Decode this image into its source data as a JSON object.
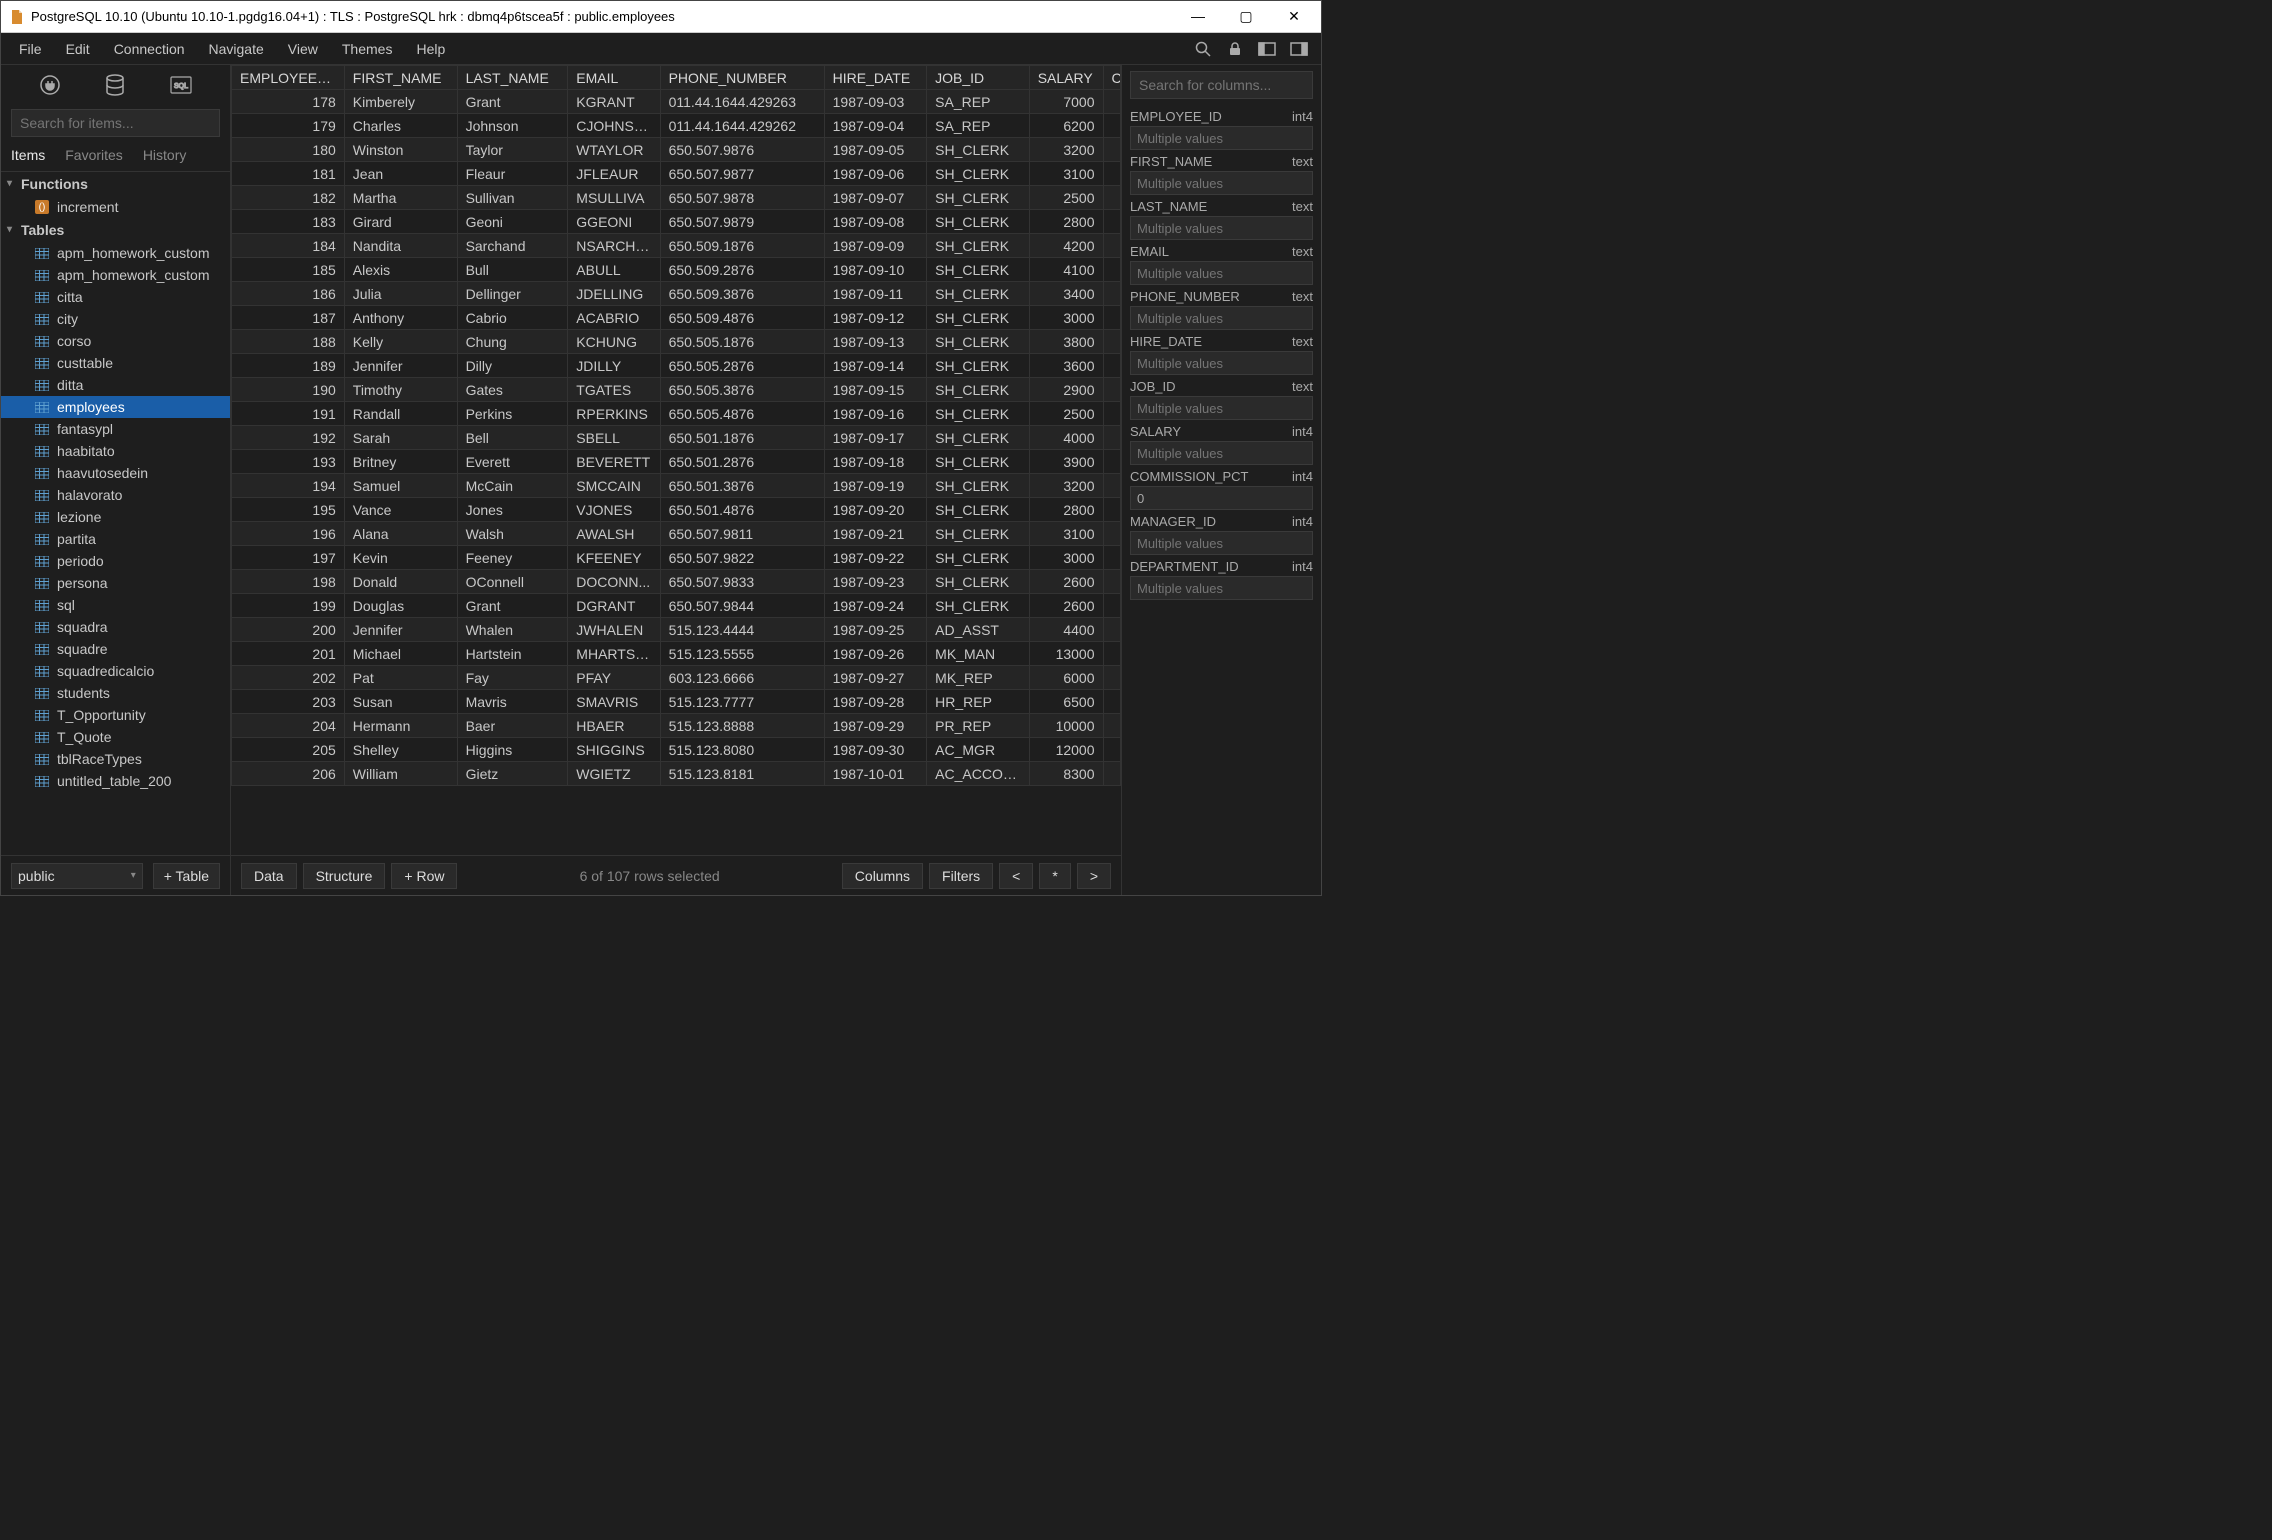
{
  "window": {
    "title": "PostgreSQL 10.10 (Ubuntu 10.10-1.pgdg16.04+1) : TLS : PostgreSQL hrk : dbmq4p6tscea5f : public.employees"
  },
  "menu": [
    "File",
    "Edit",
    "Connection",
    "Navigate",
    "View",
    "Themes",
    "Help"
  ],
  "sidebar": {
    "search_placeholder": "Search for items...",
    "tabs": [
      "Items",
      "Favorites",
      "History"
    ],
    "functions_label": "Functions",
    "tables_label": "Tables",
    "functions": [
      "increment"
    ],
    "tables": [
      "apm_homework_custom",
      "apm_homework_custom",
      "citta",
      "city",
      "corso",
      "custtable",
      "ditta",
      "employees",
      "fantasypl",
      "haabitato",
      "haavutosedein",
      "halavorato",
      "lezione",
      "partita",
      "periodo",
      "persona",
      "sql",
      "squadra",
      "squadre",
      "squadredicalcio",
      "students",
      "T_Opportunity",
      "T_Quote",
      "tblRaceTypes",
      "untitled_table_200"
    ],
    "selected_table": "employees",
    "schema": "public",
    "add_table_btn": "+ Table"
  },
  "grid": {
    "columns": [
      "EMPLOYEE_ID",
      "FIRST_NAME",
      "LAST_NAME",
      "EMAIL",
      "PHONE_NUMBER",
      "HIRE_DATE",
      "JOB_ID",
      "SALARY"
    ],
    "partial_col": "C",
    "rows": [
      [
        178,
        "Kimberely",
        "Grant",
        "KGRANT",
        "011.44.1644.429263",
        "1987-09-03",
        "SA_REP",
        7000
      ],
      [
        179,
        "Charles",
        "Johnson",
        "CJOHNSON",
        "011.44.1644.429262",
        "1987-09-04",
        "SA_REP",
        6200
      ],
      [
        180,
        "Winston",
        "Taylor",
        "WTAYLOR",
        "650.507.9876",
        "1987-09-05",
        "SH_CLERK",
        3200
      ],
      [
        181,
        "Jean",
        "Fleaur",
        "JFLEAUR",
        "650.507.9877",
        "1987-09-06",
        "SH_CLERK",
        3100
      ],
      [
        182,
        "Martha",
        "Sullivan",
        "MSULLIVA",
        "650.507.9878",
        "1987-09-07",
        "SH_CLERK",
        2500
      ],
      [
        183,
        "Girard",
        "Geoni",
        "GGEONI",
        "650.507.9879",
        "1987-09-08",
        "SH_CLERK",
        2800
      ],
      [
        184,
        "Nandita",
        "Sarchand",
        "NSARCHA...",
        "650.509.1876",
        "1987-09-09",
        "SH_CLERK",
        4200
      ],
      [
        185,
        "Alexis",
        "Bull",
        "ABULL",
        "650.509.2876",
        "1987-09-10",
        "SH_CLERK",
        4100
      ],
      [
        186,
        "Julia",
        "Dellinger",
        "JDELLING",
        "650.509.3876",
        "1987-09-11",
        "SH_CLERK",
        3400
      ],
      [
        187,
        "Anthony",
        "Cabrio",
        "ACABRIO",
        "650.509.4876",
        "1987-09-12",
        "SH_CLERK",
        3000
      ],
      [
        188,
        "Kelly",
        "Chung",
        "KCHUNG",
        "650.505.1876",
        "1987-09-13",
        "SH_CLERK",
        3800
      ],
      [
        189,
        "Jennifer",
        "Dilly",
        "JDILLY",
        "650.505.2876",
        "1987-09-14",
        "SH_CLERK",
        3600
      ],
      [
        190,
        "Timothy",
        "Gates",
        "TGATES",
        "650.505.3876",
        "1987-09-15",
        "SH_CLERK",
        2900
      ],
      [
        191,
        "Randall",
        "Perkins",
        "RPERKINS",
        "650.505.4876",
        "1987-09-16",
        "SH_CLERK",
        2500
      ],
      [
        192,
        "Sarah",
        "Bell",
        "SBELL",
        "650.501.1876",
        "1987-09-17",
        "SH_CLERK",
        4000
      ],
      [
        193,
        "Britney",
        "Everett",
        "BEVERETT",
        "650.501.2876",
        "1987-09-18",
        "SH_CLERK",
        3900
      ],
      [
        194,
        "Samuel",
        "McCain",
        "SMCCAIN",
        "650.501.3876",
        "1987-09-19",
        "SH_CLERK",
        3200
      ],
      [
        195,
        "Vance",
        "Jones",
        "VJONES",
        "650.501.4876",
        "1987-09-20",
        "SH_CLERK",
        2800
      ],
      [
        196,
        "Alana",
        "Walsh",
        "AWALSH",
        "650.507.9811",
        "1987-09-21",
        "SH_CLERK",
        3100
      ],
      [
        197,
        "Kevin",
        "Feeney",
        "KFEENEY",
        "650.507.9822",
        "1987-09-22",
        "SH_CLERK",
        3000
      ],
      [
        198,
        "Donald",
        "OConnell",
        "DOCONN...",
        "650.507.9833",
        "1987-09-23",
        "SH_CLERK",
        2600
      ],
      [
        199,
        "Douglas",
        "Grant",
        "DGRANT",
        "650.507.9844",
        "1987-09-24",
        "SH_CLERK",
        2600
      ],
      [
        200,
        "Jennifer",
        "Whalen",
        "JWHALEN",
        "515.123.4444",
        "1987-09-25",
        "AD_ASST",
        4400
      ],
      [
        201,
        "Michael",
        "Hartstein",
        "MHARTSTE",
        "515.123.5555",
        "1987-09-26",
        "MK_MAN",
        13000
      ],
      [
        202,
        "Pat",
        "Fay",
        "PFAY",
        "603.123.6666",
        "1987-09-27",
        "MK_REP",
        6000
      ],
      [
        203,
        "Susan",
        "Mavris",
        "SMAVRIS",
        "515.123.7777",
        "1987-09-28",
        "HR_REP",
        6500
      ],
      [
        204,
        "Hermann",
        "Baer",
        "HBAER",
        "515.123.8888",
        "1987-09-29",
        "PR_REP",
        10000
      ],
      [
        205,
        "Shelley",
        "Higgins",
        "SHIGGINS",
        "515.123.8080",
        "1987-09-30",
        "AC_MGR",
        12000
      ],
      [
        206,
        "William",
        "Gietz",
        "WGIETZ",
        "515.123.8181",
        "1987-10-01",
        "AC_ACCOUNT",
        8300
      ]
    ]
  },
  "footer": {
    "data_btn": "Data",
    "structure_btn": "Structure",
    "row_btn": "+ Row",
    "status": "6 of 107 rows selected",
    "columns_btn": "Columns",
    "filters_btn": "Filters",
    "nav_prev": "<",
    "nav_all": "*",
    "nav_next": ">"
  },
  "rightp": {
    "search_placeholder": "Search for columns...",
    "multi_placeholder": "Multiple values",
    "fields": [
      {
        "name": "EMPLOYEE_ID",
        "type": "int4",
        "value": ""
      },
      {
        "name": "FIRST_NAME",
        "type": "text",
        "value": ""
      },
      {
        "name": "LAST_NAME",
        "type": "text",
        "value": ""
      },
      {
        "name": "EMAIL",
        "type": "text",
        "value": ""
      },
      {
        "name": "PHONE_NUMBER",
        "type": "text",
        "value": ""
      },
      {
        "name": "HIRE_DATE",
        "type": "text",
        "value": ""
      },
      {
        "name": "JOB_ID",
        "type": "text",
        "value": ""
      },
      {
        "name": "SALARY",
        "type": "int4",
        "value": ""
      },
      {
        "name": "COMMISSION_PCT",
        "type": "int4",
        "value": "0"
      },
      {
        "name": "MANAGER_ID",
        "type": "int4",
        "value": ""
      },
      {
        "name": "DEPARTMENT_ID",
        "type": "int4",
        "value": ""
      }
    ]
  }
}
